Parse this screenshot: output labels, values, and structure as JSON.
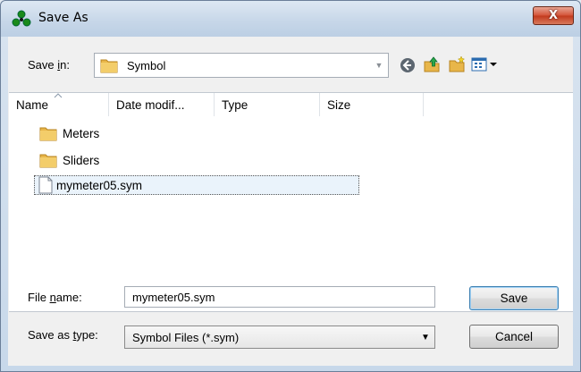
{
  "window": {
    "title": "Save As",
    "close_label": "X"
  },
  "toolbar": {
    "save_in_label_pre": "Save ",
    "save_in_label_u": "i",
    "save_in_label_post": "n:",
    "save_in_value": "Symbol"
  },
  "columns": [
    "Name",
    "Date modif...",
    "Type",
    "Size"
  ],
  "items": [
    {
      "label": "Meters",
      "kind": "folder"
    },
    {
      "label": "Sliders",
      "kind": "folder"
    },
    {
      "label": "mymeter05.sym",
      "kind": "file",
      "selected": true
    }
  ],
  "form": {
    "filename_label_pre": "File ",
    "filename_label_u": "n",
    "filename_label_post": "ame:",
    "filename_value": "mymeter05.sym",
    "type_label_pre": "Save as ",
    "type_label_u": "t",
    "type_label_post": "ype:",
    "type_value": "Symbol Files (*.sym)"
  },
  "buttons": {
    "save": "Save",
    "cancel": "Cancel"
  },
  "colors": {
    "accent": "#3c7fb1",
    "folder": "#e8b64a"
  }
}
